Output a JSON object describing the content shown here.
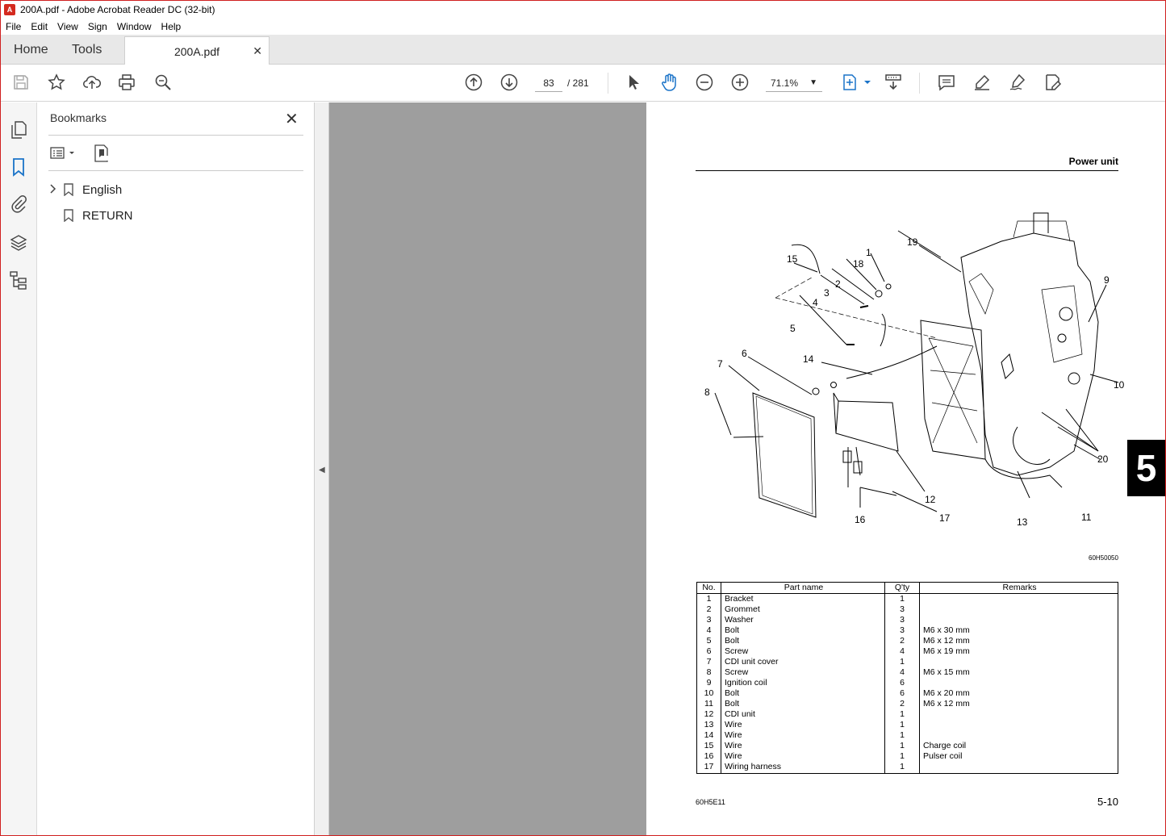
{
  "window": {
    "title": "200A.pdf - Adobe Acrobat Reader DC (32-bit)"
  },
  "menu": [
    "File",
    "Edit",
    "View",
    "Sign",
    "Window",
    "Help"
  ],
  "tabs": {
    "home": "Home",
    "tools": "Tools",
    "document": "200A.pdf"
  },
  "toolbar": {
    "page_current": "83",
    "page_total": "/ 281",
    "zoom": "71.1%"
  },
  "bookmarks": {
    "title": "Bookmarks",
    "items": [
      {
        "label": "English",
        "expandable": true
      },
      {
        "label": "RETURN",
        "expandable": false
      }
    ]
  },
  "page": {
    "section_title": "Power unit",
    "figure_code": "60H50050",
    "footer_left": "60H5E11",
    "footer_right": "5-10",
    "chapter_tab": "5",
    "callouts": [
      "1",
      "2",
      "3",
      "4",
      "5",
      "6",
      "7",
      "8",
      "9",
      "10",
      "11",
      "12",
      "13",
      "14",
      "15",
      "16",
      "17",
      "18",
      "19",
      "20"
    ],
    "table": {
      "headers": [
        "No.",
        "Part name",
        "Q'ty",
        "Remarks"
      ],
      "rows": [
        [
          "1",
          "Bracket",
          "1",
          ""
        ],
        [
          "2",
          "Grommet",
          "3",
          ""
        ],
        [
          "3",
          "Washer",
          "3",
          ""
        ],
        [
          "4",
          "Bolt",
          "3",
          "M6 x 30 mm"
        ],
        [
          "5",
          "Bolt",
          "2",
          "M6 x 12 mm"
        ],
        [
          "6",
          "Screw",
          "4",
          "M6 x 19 mm"
        ],
        [
          "7",
          "CDI unit cover",
          "1",
          ""
        ],
        [
          "8",
          "Screw",
          "4",
          "M6 x 15 mm"
        ],
        [
          "9",
          "Ignition coil",
          "6",
          ""
        ],
        [
          "10",
          "Bolt",
          "6",
          "M6 x 20 mm"
        ],
        [
          "11",
          "Bolt",
          "2",
          "M6 x 12 mm"
        ],
        [
          "12",
          "CDI unit",
          "1",
          ""
        ],
        [
          "13",
          "Wire",
          "1",
          ""
        ],
        [
          "14",
          "Wire",
          "1",
          ""
        ],
        [
          "15",
          "Wire",
          "1",
          "Charge coil"
        ],
        [
          "16",
          "Wire",
          "1",
          "Pulser coil"
        ],
        [
          "17",
          "Wiring harness",
          "1",
          ""
        ]
      ]
    }
  }
}
